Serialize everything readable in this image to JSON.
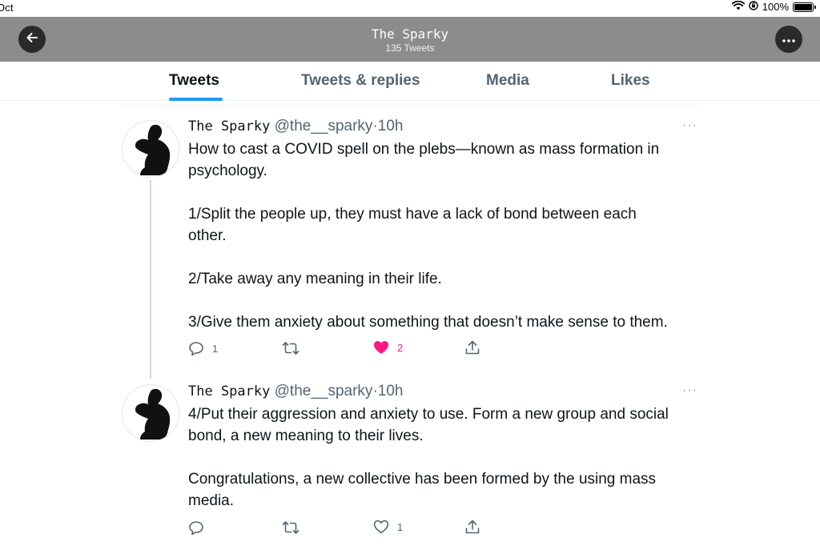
{
  "status_bar": {
    "date_fragment": "Oct",
    "battery_text": "100%",
    "icons": [
      "wifi-icon",
      "orientation-lock-icon",
      "battery-icon"
    ]
  },
  "header": {
    "title": "The Sparky",
    "subtitle": "135 Tweets",
    "back_icon": "arrow-left-icon",
    "more_icon": "more-horizontal-icon"
  },
  "tabs": [
    {
      "label": "Tweets",
      "active": true
    },
    {
      "label": "Tweets & replies",
      "active": false
    },
    {
      "label": "Media",
      "active": false
    },
    {
      "label": "Likes",
      "active": false
    }
  ],
  "tweets": [
    {
      "display_name": "The Sparky",
      "handle": "@the__sparky",
      "separator": "·",
      "time": "10h",
      "text": "How to cast a COVID spell on the plebs—known as mass formation in\npsychology.\n\n1/Split the people up, they must have a lack of bond between each\nother.\n\n2/Take away any meaning in their life.\n\n3/Give them anxiety about something that doesn’t make sense to them.",
      "reply_count": "1",
      "retweet_count": "",
      "like_count": "2",
      "liked": true
    },
    {
      "display_name": "The Sparky",
      "handle": "@the__sparky",
      "separator": "·",
      "time": "10h",
      "text": "4/Put their aggression and anxiety to use. Form a new group and social\nbond, a new meaning to their lives.\n\nCongratulations, a new collective has been formed by the using mass\nmedia.",
      "reply_count": "",
      "retweet_count": "",
      "like_count": "1",
      "liked": false
    }
  ],
  "colors": {
    "header_bg": "#8c8c8c",
    "accent": "#1d9bf0",
    "like": "#f91880",
    "secondary_text": "#536471"
  }
}
